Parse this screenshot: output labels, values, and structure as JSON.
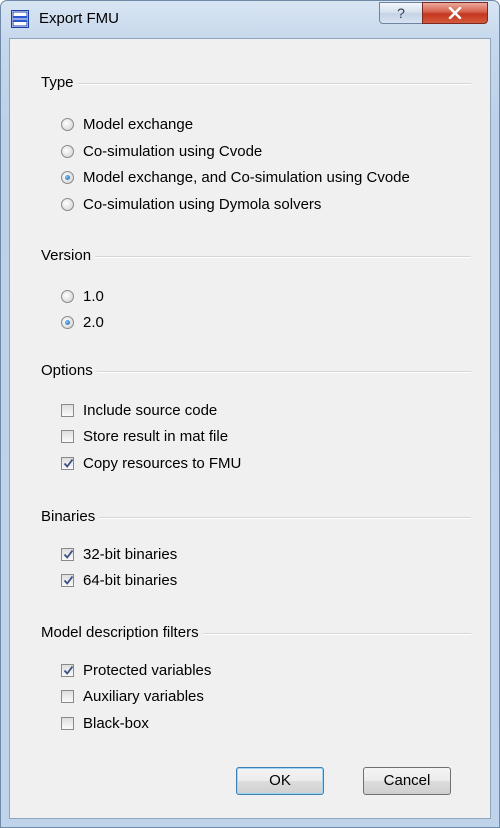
{
  "window": {
    "title": "Export FMU",
    "help_glyph": "?",
    "close_glyph": "X"
  },
  "groups": {
    "type": {
      "title": "Type",
      "options": [
        {
          "label": "Model exchange",
          "checked": false
        },
        {
          "label": "Co-simulation using Cvode",
          "checked": false
        },
        {
          "label": "Model exchange, and Co-simulation using Cvode",
          "checked": true
        },
        {
          "label": "Co-simulation using Dymola solvers",
          "checked": false
        }
      ]
    },
    "version": {
      "title": "Version",
      "options": [
        {
          "label": "1.0",
          "checked": false
        },
        {
          "label": "2.0",
          "checked": true
        }
      ]
    },
    "options": {
      "title": "Options",
      "items": [
        {
          "label": "Include source code",
          "checked": false
        },
        {
          "label": "Store result in mat file",
          "checked": false
        },
        {
          "label": "Copy resources to FMU",
          "checked": true
        }
      ]
    },
    "binaries": {
      "title": "Binaries",
      "items": [
        {
          "label": "32-bit binaries",
          "checked": true
        },
        {
          "label": "64-bit binaries",
          "checked": true
        }
      ]
    },
    "filters": {
      "title": "Model description filters",
      "items": [
        {
          "label": "Protected variables",
          "checked": true
        },
        {
          "label": "Auxiliary variables",
          "checked": false
        },
        {
          "label": "Black-box",
          "checked": false
        }
      ]
    }
  },
  "buttons": {
    "ok": "OK",
    "cancel": "Cancel"
  }
}
